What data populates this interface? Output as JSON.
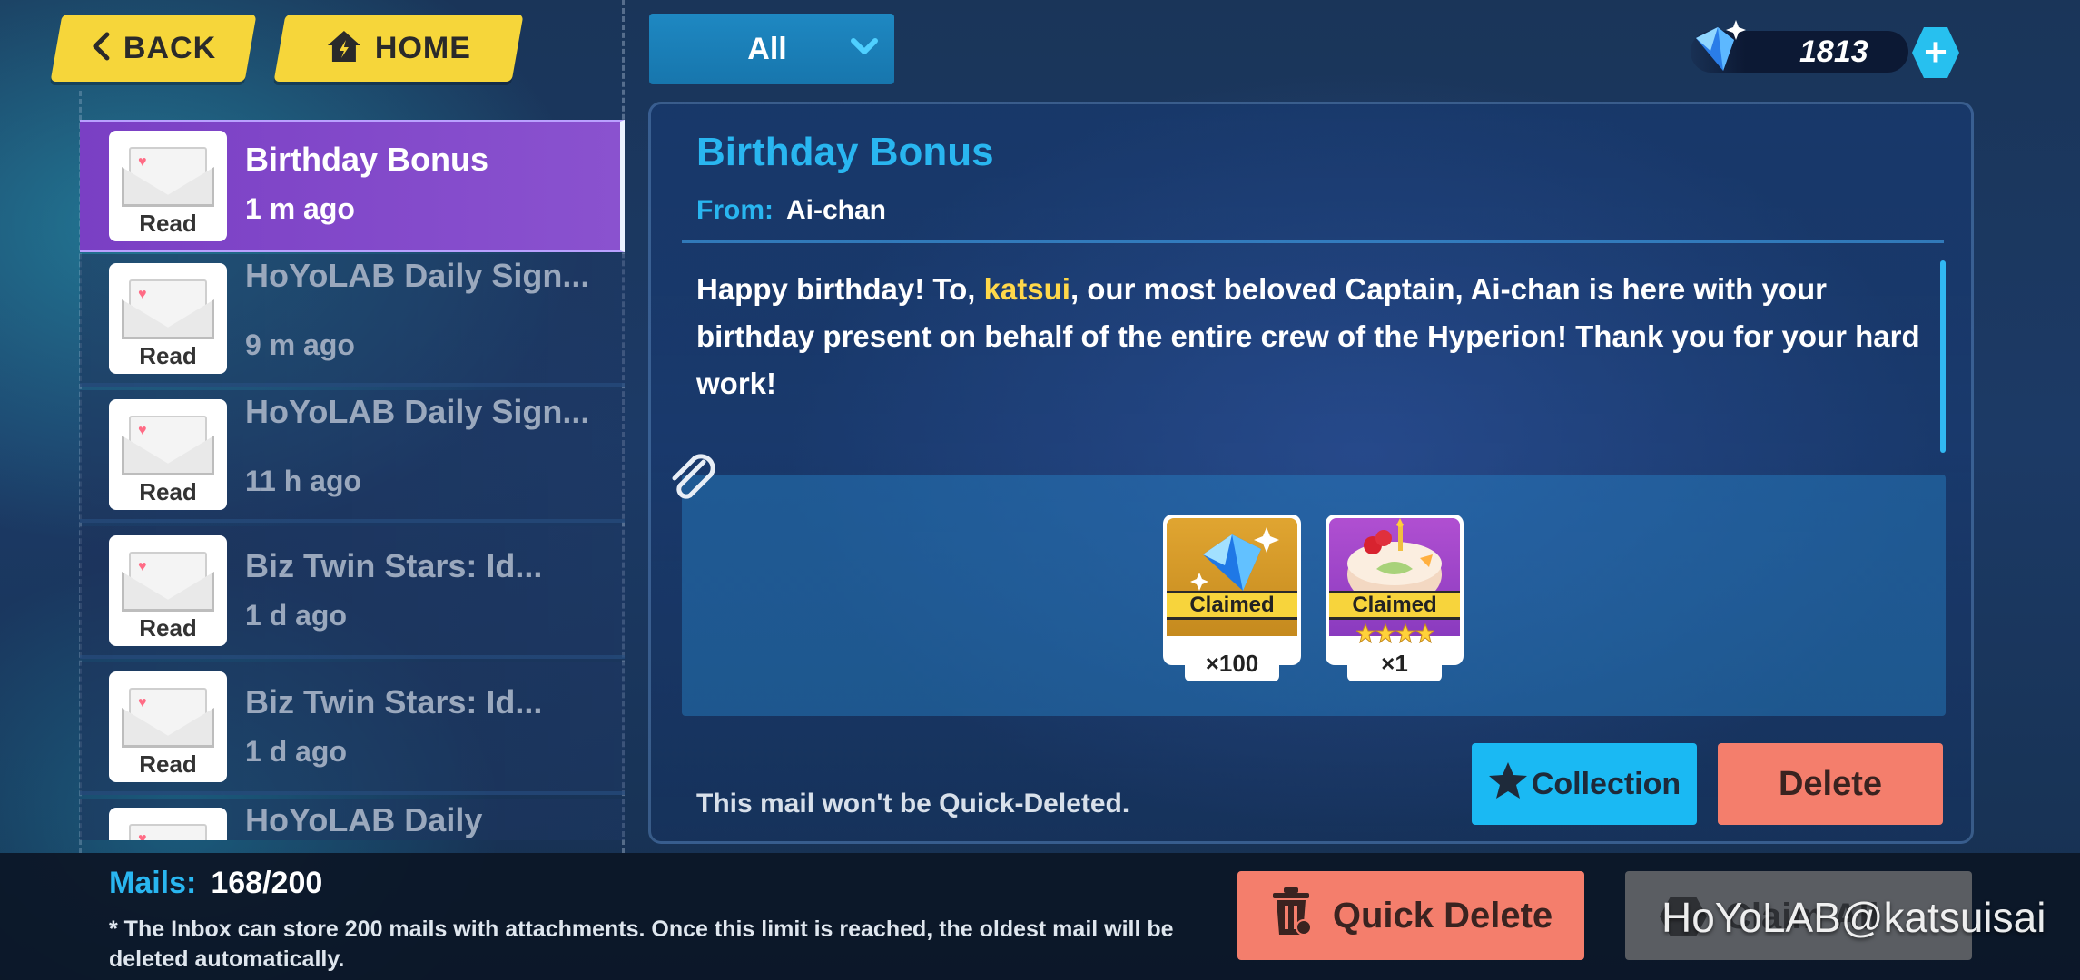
{
  "nav": {
    "back_label": "BACK",
    "home_label": "HOME"
  },
  "filter": {
    "selected": "All"
  },
  "currency": {
    "amount": "1813",
    "plus_label": "+"
  },
  "mail_list": [
    {
      "title": "Birthday Bonus",
      "time": "1 m ago",
      "status": "Read",
      "active": true
    },
    {
      "title": "HoYoLAB Daily Sign...",
      "time": "9 m ago",
      "status": "Read"
    },
    {
      "title": "HoYoLAB Daily Sign...",
      "time": "11 h ago",
      "status": "Read"
    },
    {
      "title": "Biz Twin Stars: Id...",
      "time": "1 d ago",
      "status": "Read"
    },
    {
      "title": "Biz Twin Stars: Id...",
      "time": "1 d ago",
      "status": "Read"
    },
    {
      "title": "HoYoLAB Daily",
      "time": "",
      "status": ""
    }
  ],
  "detail": {
    "title": "Birthday Bonus",
    "from_label": "From:",
    "from_value": "Ai-chan",
    "body_pre": "Happy birthday! To, ",
    "body_highlight": "katsui",
    "body_post": ", our most beloved Captain, Ai-chan is here with your birthday present on behalf of the entire crew of the Hyperion! Thank you for your hard work!",
    "attachments": [
      {
        "name": "crystal",
        "status": "Claimed",
        "qty": "×100"
      },
      {
        "name": "cake",
        "status": "Claimed",
        "qty": "×1",
        "stars": 4
      }
    ],
    "quick_delete_note": "This mail won't be Quick-Deleted.",
    "collection_label": "Collection",
    "delete_label": "Delete"
  },
  "footer": {
    "mails_label": "Mails:",
    "mails_value": "168/200",
    "inbox_note": "* The Inbox can store 200 mails with attachments. Once this limit is reached, the oldest mail will be deleted automatically.",
    "quick_delete_label": "Quick Delete",
    "claim_all_label": "Claim All"
  },
  "watermark": "HoYoLAB@katsuisai",
  "colors": {
    "accent": "#29b6f0",
    "highlight": "#ffd84a",
    "active_mail": "#7a3fc4",
    "delete": "#f47e6c",
    "nav_yellow": "#f6d63a"
  }
}
